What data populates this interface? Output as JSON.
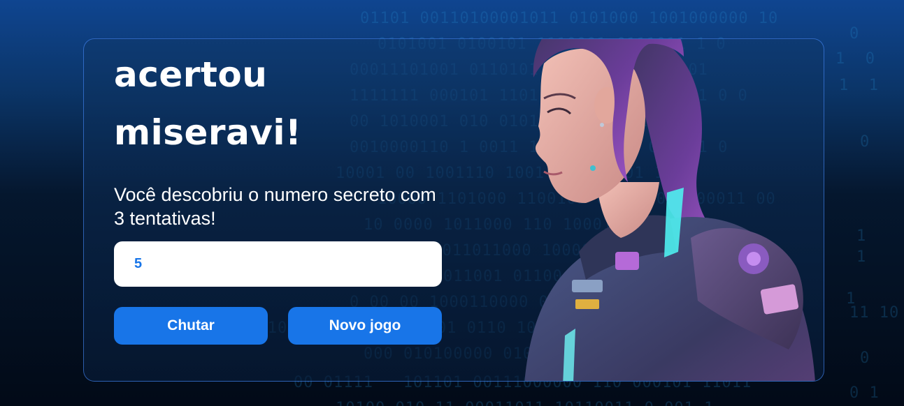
{
  "game": {
    "title_line1": "acertou",
    "title_line2": "miseravi!",
    "message": "Você descobriu o numero secreto com 3 tentativas!",
    "input_value": "5",
    "guess_button": "Chutar",
    "new_game_button": "Novo jogo"
  },
  "colors": {
    "accent": "#1875e8",
    "text": "#ffffff",
    "background_top": "#0f4590",
    "background_bottom": "#020a17"
  },
  "images": {
    "hero": "cyberpunk-girl-purple-hair-illustration"
  }
}
